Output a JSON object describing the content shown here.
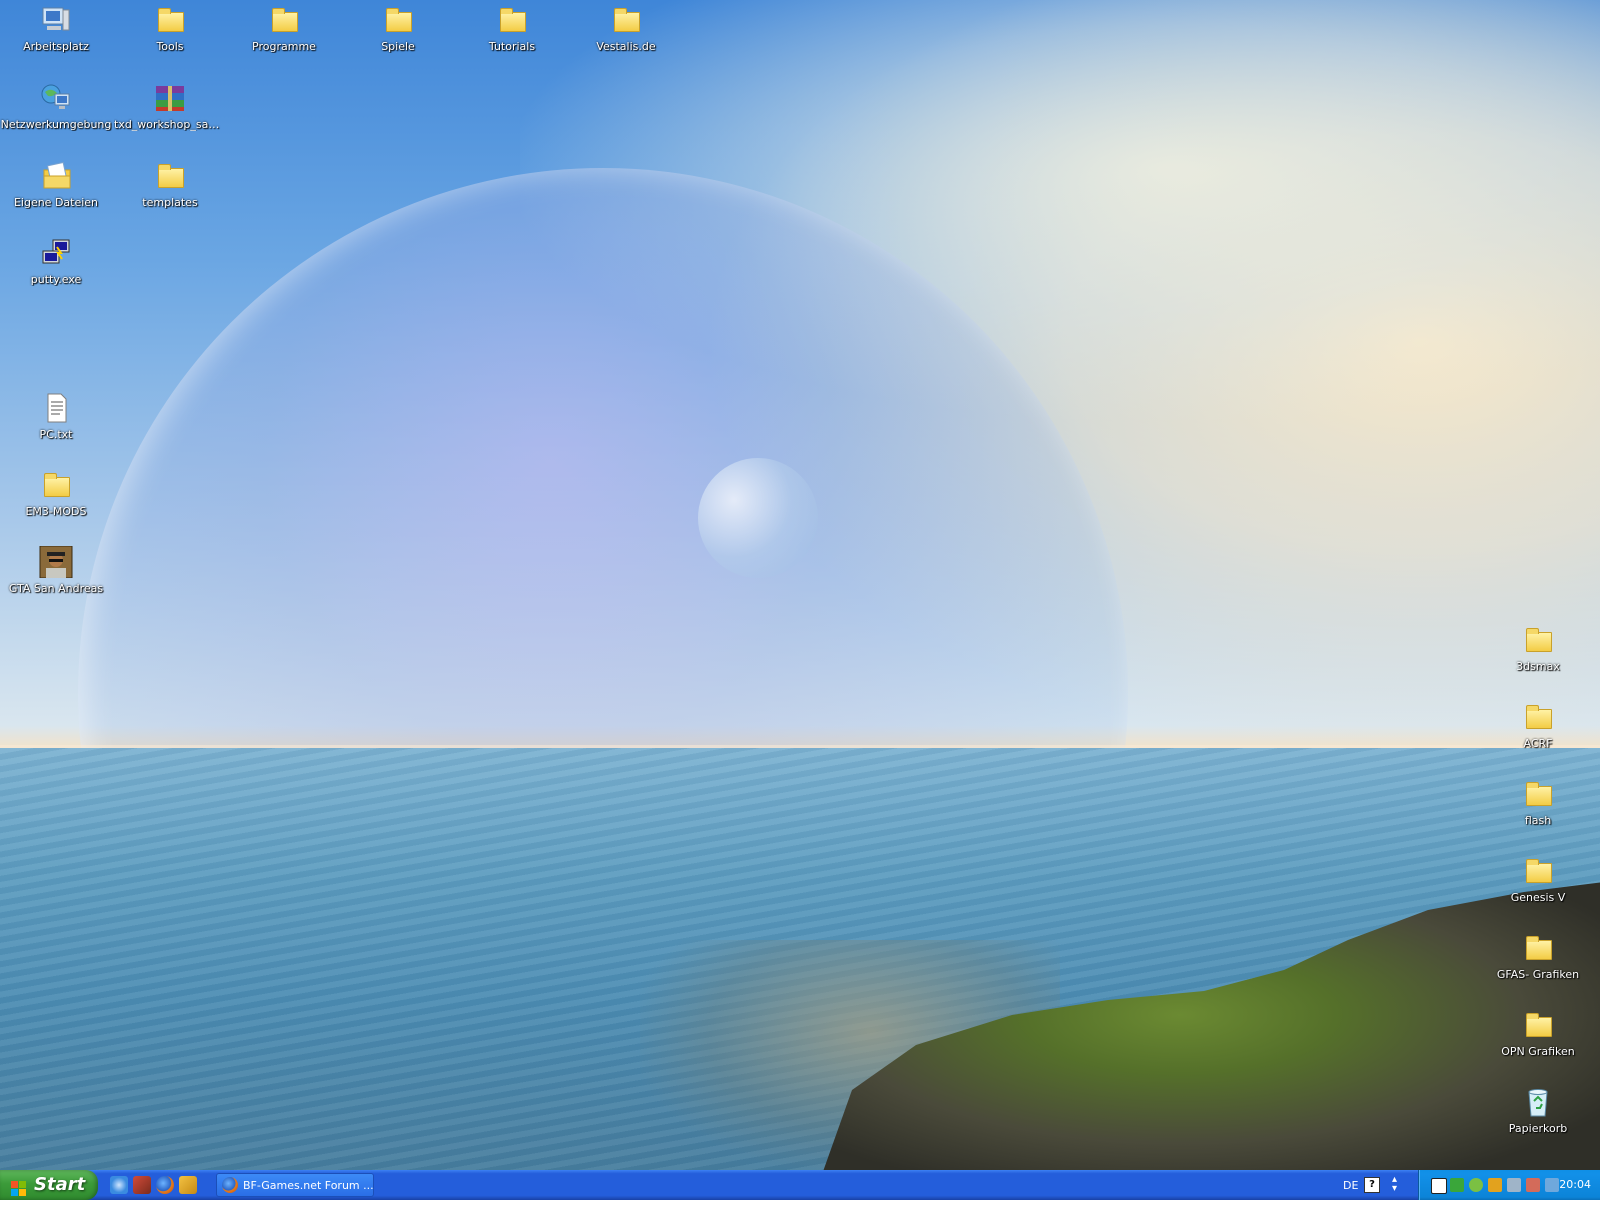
{
  "desktop": {
    "icons_left": [
      {
        "label": "Arbeitsplatz",
        "icon": "my-computer-icon"
      },
      {
        "label": "Tools",
        "icon": "folder-icon"
      },
      {
        "label": "Programme",
        "icon": "folder-icon"
      },
      {
        "label": "Spiele",
        "icon": "folder-icon"
      },
      {
        "label": "Tutorials",
        "icon": "folder-icon"
      },
      {
        "label": "Vestalis.de",
        "icon": "folder-icon"
      },
      {
        "label": "Netzwerkumgebung",
        "icon": "network-icon"
      },
      {
        "label": "txd_workshop_sana...",
        "icon": "winrar-archive-icon"
      },
      {
        "label": "Eigene Dateien",
        "icon": "my-documents-icon"
      },
      {
        "label": "templates",
        "icon": "folder-icon"
      },
      {
        "label": "putty.exe",
        "icon": "putty-icon"
      },
      {
        "label": "PC.txt",
        "icon": "text-file-icon"
      },
      {
        "label": "EM3-MODS",
        "icon": "folder-icon"
      },
      {
        "label": "GTA San Andreas",
        "icon": "gta-icon"
      }
    ],
    "icons_right": [
      {
        "label": "3dsmax",
        "icon": "folder-icon"
      },
      {
        "label": "ACRF",
        "icon": "folder-icon"
      },
      {
        "label": "flash",
        "icon": "folder-icon"
      },
      {
        "label": "Genesis V",
        "icon": "folder-icon"
      },
      {
        "label": "GFAS- Grafiken",
        "icon": "folder-icon"
      },
      {
        "label": "OPN Grafiken",
        "icon": "folder-icon"
      },
      {
        "label": "Papierkorb",
        "icon": "recycle-bin-icon"
      }
    ]
  },
  "taskbar": {
    "start_label": "Start",
    "quick_launch": [
      "internet-explorer-icon",
      "media-icon",
      "firefox-icon",
      "winamp-icon"
    ],
    "task_button_label": "BF-Games.net Forum ...",
    "language": "DE",
    "help_glyph": "?",
    "clock": "20:04",
    "colors": {
      "taskbar": "#245edb",
      "start": "#3c9b3a",
      "tray": "#0f8fe6"
    }
  }
}
